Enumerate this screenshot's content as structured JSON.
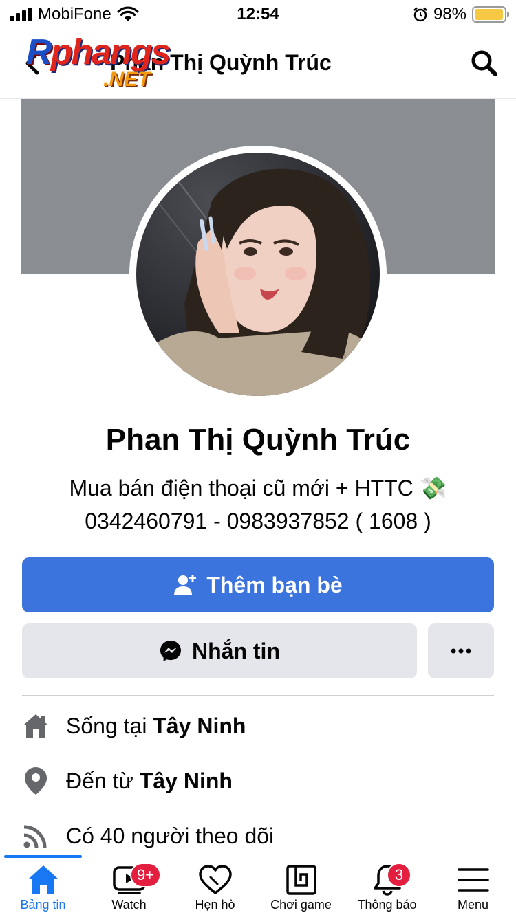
{
  "status_bar": {
    "carrier": "MobiFone",
    "time": "12:54",
    "battery": "98%",
    "battery_level": 0.98,
    "battery_color": "#f7c843",
    "icons": [
      "signal-icon",
      "wifi-icon",
      "alarm-icon",
      "battery-icon"
    ]
  },
  "header": {
    "title": "Phan Thị Quỳnh Trúc",
    "back_icon": "chevron-left-icon",
    "search_icon": "search-icon",
    "watermark": {
      "top": "Rphangs",
      "bottom": ".NET"
    }
  },
  "profile": {
    "name": "Phan Thị Quỳnh Trúc",
    "bio_line1": "Mua bán điện thoại cũ mới + HTTC 💸",
    "bio_line2": "0342460791 - 0983937852 ( 1608 )"
  },
  "actions": {
    "add_friend": "Thêm bạn bè",
    "message": "Nhắn tin",
    "more": "more-icon"
  },
  "details": [
    {
      "icon": "home-icon",
      "prefix": "Sống tại ",
      "bold": "Tây Ninh"
    },
    {
      "icon": "location-pin-icon",
      "prefix": "Đến từ ",
      "bold": "Tây Ninh"
    },
    {
      "icon": "rss-icon",
      "text": "Có 40 người theo dõi"
    }
  ],
  "tabbar": {
    "active_color": "#1877f2",
    "tabs": [
      {
        "label": "Bảng tin",
        "icon": "home-icon",
        "active": true
      },
      {
        "label": "Watch",
        "icon": "watch-icon",
        "badge": "9+"
      },
      {
        "label": "Hẹn hò",
        "icon": "heart-icon"
      },
      {
        "label": "Chơi game",
        "icon": "gaming-icon"
      },
      {
        "label": "Thông báo",
        "icon": "bell-icon",
        "badge": "3"
      },
      {
        "label": "Menu",
        "icon": "menu-icon"
      }
    ]
  },
  "colors": {
    "primary": "#3b74dd",
    "secondary_button": "#e4e6eb",
    "cover": "#8a8d91",
    "badge": "#e41e3f"
  }
}
